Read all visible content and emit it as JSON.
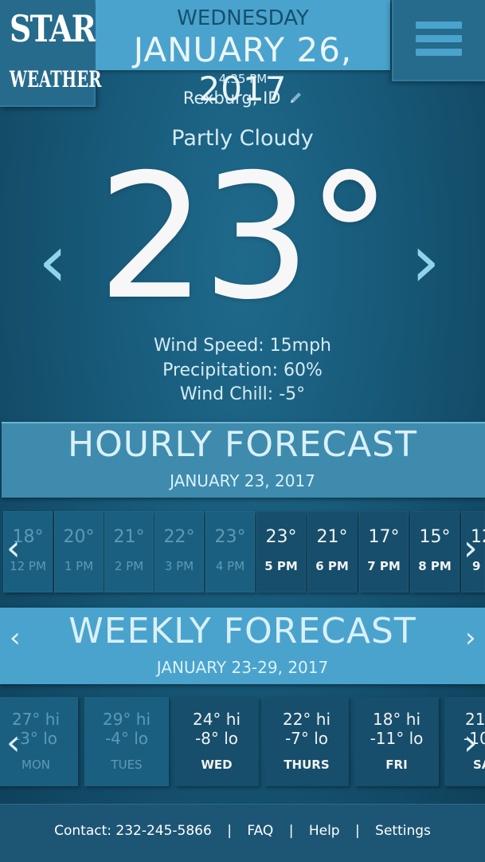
{
  "app": {
    "logo_top": "STAR",
    "logo_bottom": "WEATHER"
  },
  "header": {
    "weekday": "WEDNESDAY",
    "date": "JANUARY 26, 2017",
    "time": "4:35 PM",
    "location": "Rexburg, ID"
  },
  "current": {
    "condition": "Partly Cloudy",
    "temperature": "23°",
    "wind_speed": "Wind Speed: 15mph",
    "precipitation": "Precipitation: 60%",
    "wind_chill": "Wind Chill: -5°"
  },
  "hourly": {
    "title": "HOURLY FORECAST",
    "date": "JANUARY 23, 2017",
    "items": [
      {
        "temp": "18°",
        "hour": "12 PM",
        "state": "past"
      },
      {
        "temp": "20°",
        "hour": "1 PM",
        "state": "past"
      },
      {
        "temp": "21°",
        "hour": "2 PM",
        "state": "past"
      },
      {
        "temp": "22°",
        "hour": "3 PM",
        "state": "past"
      },
      {
        "temp": "23°",
        "hour": "4 PM",
        "state": "past"
      },
      {
        "temp": "23°",
        "hour": "5 PM",
        "state": "future"
      },
      {
        "temp": "21°",
        "hour": "6 PM",
        "state": "future"
      },
      {
        "temp": "17°",
        "hour": "7 PM",
        "state": "future"
      },
      {
        "temp": "15°",
        "hour": "8 PM",
        "state": "future"
      },
      {
        "temp": "12",
        "hour": "9",
        "state": "future"
      }
    ]
  },
  "weekly": {
    "title": "WEEKLY FORECAST",
    "range": "JANUARY 23-29, 2017",
    "days": [
      {
        "hi": "27° hi",
        "lo": "-3° lo",
        "day": "MON",
        "state": "past"
      },
      {
        "hi": "29° hi",
        "lo": "-4° lo",
        "day": "TUES",
        "state": "past"
      },
      {
        "hi": "24° hi",
        "lo": "-8° lo",
        "day": "WED",
        "state": "future"
      },
      {
        "hi": "22° hi",
        "lo": "-7° lo",
        "day": "THURS",
        "state": "future"
      },
      {
        "hi": "18° hi",
        "lo": "-11° lo",
        "day": "FRI",
        "state": "future"
      },
      {
        "hi": "21°",
        "lo": "-10",
        "day": "SA",
        "state": "future"
      }
    ]
  },
  "footer": {
    "contact": "Contact: 232-245-5866",
    "faq": "FAQ",
    "help": "Help",
    "settings": "Settings",
    "separator": "|"
  },
  "icons": {
    "menu": "hamburger-menu-icon",
    "edit": "pencil-icon",
    "prev": "chevron-left-icon",
    "next": "chevron-right-icon"
  },
  "colors": {
    "accent": "#4aa3cc",
    "background": "#175877",
    "panel": "#266b8c"
  }
}
